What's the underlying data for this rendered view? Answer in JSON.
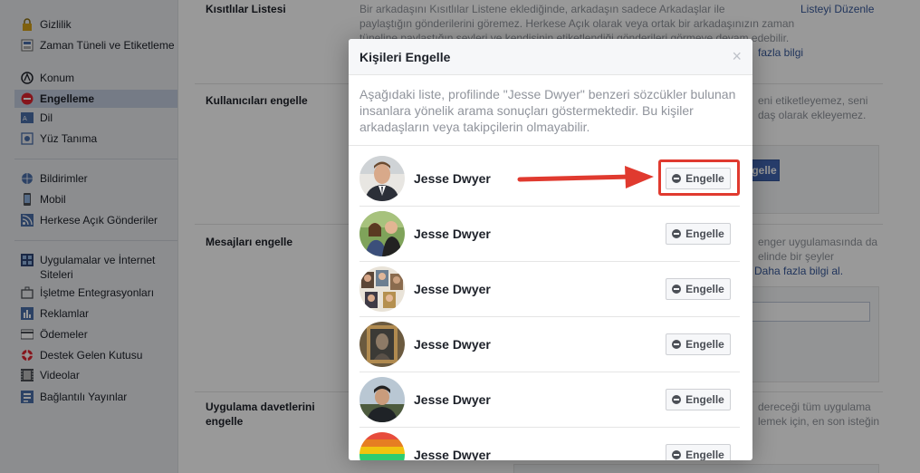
{
  "sidebar": {
    "items": [
      {
        "label": "Gizlilik",
        "icon": "lock-icon"
      },
      {
        "label": "Zaman Tüneli ve Etiketleme",
        "icon": "timeline-icon"
      },
      {
        "label": "Konum",
        "icon": "location-icon"
      },
      {
        "label": "Engelleme",
        "icon": "block-icon",
        "active": true
      },
      {
        "label": "Dil",
        "icon": "language-icon"
      },
      {
        "label": "Yüz Tanıma",
        "icon": "face-recognition-icon"
      },
      {
        "label": "Bildirimler",
        "icon": "globe-icon"
      },
      {
        "label": "Mobil",
        "icon": "mobile-icon"
      },
      {
        "label": "Herkese Açık Gönderiler",
        "icon": "rss-icon"
      },
      {
        "label": "Uygulamalar ve İnternet Siteleri",
        "icon": "apps-icon"
      },
      {
        "label": "İşletme Entegrasyonları",
        "icon": "business-icon"
      },
      {
        "label": "Reklamlar",
        "icon": "ads-icon"
      },
      {
        "label": "Ödemeler",
        "icon": "payments-icon"
      },
      {
        "label": "Destek Gelen Kutusu",
        "icon": "support-icon"
      },
      {
        "label": "Videolar",
        "icon": "video-icon"
      },
      {
        "label": "Bağlantılı Yayınlar",
        "icon": "linked-publications-icon"
      }
    ]
  },
  "content": {
    "restricted": {
      "title": "Kısıtlılar Listesi",
      "text1": "Bir arkadaşını Kısıtlılar Listene eklediğinde, arkadaşın sadece Arkadaşlar ile",
      "text2": "paylaştığın gönderilerini göremez. Herkese Açık olarak veya ortak bir arkadaşınızın zaman",
      "text3": "tüneline paylaştığın şeyleri ve kendisinin etiketlendiği gönderileri görmeye devam edebilir.",
      "edit_link": "Listeyi Düzenle",
      "more_link": "fazla bilgi"
    },
    "block_users": {
      "title": "Kullanıcıları engelle",
      "text1": "eni etiketleyemez, seni",
      "text2": "daş olarak ekleyemez.",
      "button": "gelle"
    },
    "block_messages": {
      "title": "Mesajları engelle",
      "text1": "enger uygulamasında da",
      "text2": "elinde bir şeyler",
      "link": "Daha fazla bilgi al."
    },
    "block_invites": {
      "title1": "Uygulama davetlerini",
      "title2": "engelle",
      "text1": "dereceği tüm uygulama",
      "text2": "lemek için, en son isteğin"
    }
  },
  "modal": {
    "title": "Kişileri Engelle",
    "close": "×",
    "description": "Aşağıdaki liste, profilinde \"Jesse Dwyer\" benzeri sözcükler bulunan insanlara yönelik arama sonuçları göstermektedir. Bu kişiler arkadaşların veya takipçilerin olmayabilir.",
    "people": [
      {
        "name": "Jesse Dwyer",
        "button": "Engelle"
      },
      {
        "name": "Jesse Dwyer",
        "button": "Engelle"
      },
      {
        "name": "Jesse Dwyer",
        "button": "Engelle"
      },
      {
        "name": "Jesse Dwyer",
        "button": "Engelle"
      },
      {
        "name": "Jesse Dwyer",
        "button": "Engelle"
      },
      {
        "name": "Jesse Dwyer",
        "button": "Engelle"
      }
    ]
  },
  "colors": {
    "accent": "#4267b2",
    "annotation": "#e03a2f",
    "active_item": "#c4cddf"
  }
}
